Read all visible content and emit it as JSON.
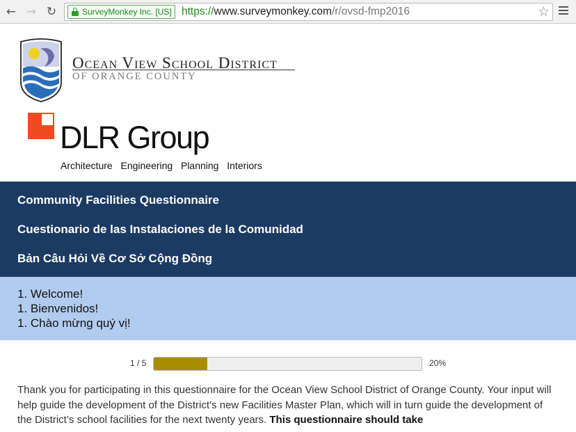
{
  "browser": {
    "ev_badge": "SurveyMonkey Inc. [US]",
    "url_scheme": "https://",
    "url_host": "www.surveymonkey.com",
    "url_path": "/r/ovsd-fmp2016",
    "back_icon": "arrow-left-icon",
    "forward_icon": "arrow-right-icon",
    "reload_icon": "reload-icon",
    "bookmark_icon": "star-icon",
    "menu_icon": "hamburger-menu-icon"
  },
  "header": {
    "district_name": "Ocean View School District",
    "district_sub": "OF ORANGE COUNTY",
    "firm_name": "DLR Group",
    "firm_tagline": "Architecture  Engineering  Planning  Interiors"
  },
  "survey": {
    "title_en": "Community Facilities Questionnaire",
    "title_es": "Cuestionario de las Instalaciones de la Comunidad",
    "title_vi": "Bản Câu Hỏi Về Cơ Sở Cộng Đồng",
    "page_en": "1. Welcome!",
    "page_es": "1. Bienvenidos!",
    "page_vi": "1. Chào mừng quý vị!"
  },
  "progress": {
    "page_label": "1 / 5",
    "percent_label": "20%",
    "fraction": 0.2
  },
  "intro": {
    "text": "Thank you for participating in this questionnaire for the Ocean View School District of Orange County. Your input will help guide the development of the District’s new Facilities Master Plan, which will in turn guide the development of the District’s school facilities for the next twenty years. ",
    "bold": "This questionnaire should take"
  },
  "colors": {
    "title_band": "#1c3b63",
    "page_band": "#b2ccf0",
    "progress_fill": "#a88d00",
    "dlr_red": "#ef4b23"
  }
}
